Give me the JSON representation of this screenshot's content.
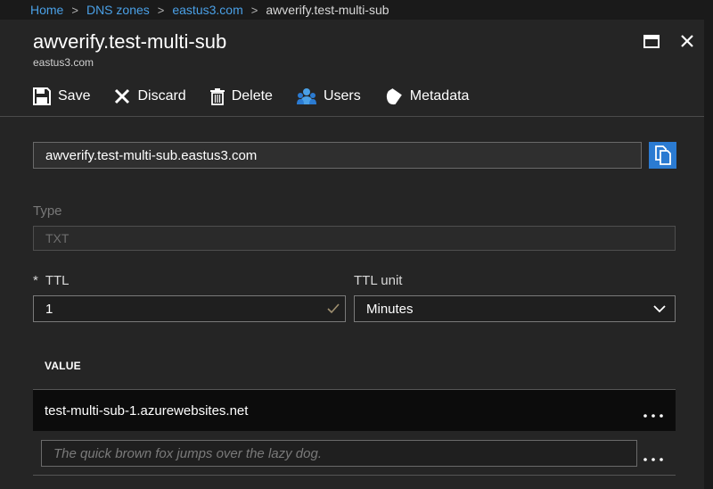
{
  "breadcrumb": {
    "items": [
      "Home",
      "DNS zones",
      "eastus3.com"
    ],
    "current": "awverify.test-multi-sub"
  },
  "blade": {
    "title": "awverify.test-multi-sub",
    "subtitle": "eastus3.com"
  },
  "toolbar": {
    "save_label": "Save",
    "discard_label": "Discard",
    "delete_label": "Delete",
    "users_label": "Users",
    "metadata_label": "Metadata"
  },
  "form": {
    "fqdn_value": "awverify.test-multi-sub.eastus3.com",
    "type_label": "Type",
    "type_value": "TXT",
    "ttl_required_mark": "*",
    "ttl_label": "TTL",
    "ttl_value": "1",
    "ttl_unit_label": "TTL unit",
    "ttl_unit_value": "Minutes"
  },
  "values_table": {
    "header": "VALUE",
    "rows": [
      "test-multi-sub-1.azurewebsites.net"
    ],
    "new_value_placeholder": "The quick brown fox jumps over the lazy dog."
  },
  "icons": {
    "save": "save-icon",
    "discard": "close-x-icon",
    "delete": "trash-icon",
    "users": "users-icon",
    "metadata": "tag-icon",
    "copy": "copy-icon",
    "maximize": "maximize-icon",
    "close": "close-icon",
    "check": "check-icon",
    "chevron": "chevron-down-icon",
    "more": "more-ellipsis-icon"
  },
  "colors": {
    "accent": "#2b7bd2",
    "link": "#4aa0e6",
    "background": "#252525"
  }
}
